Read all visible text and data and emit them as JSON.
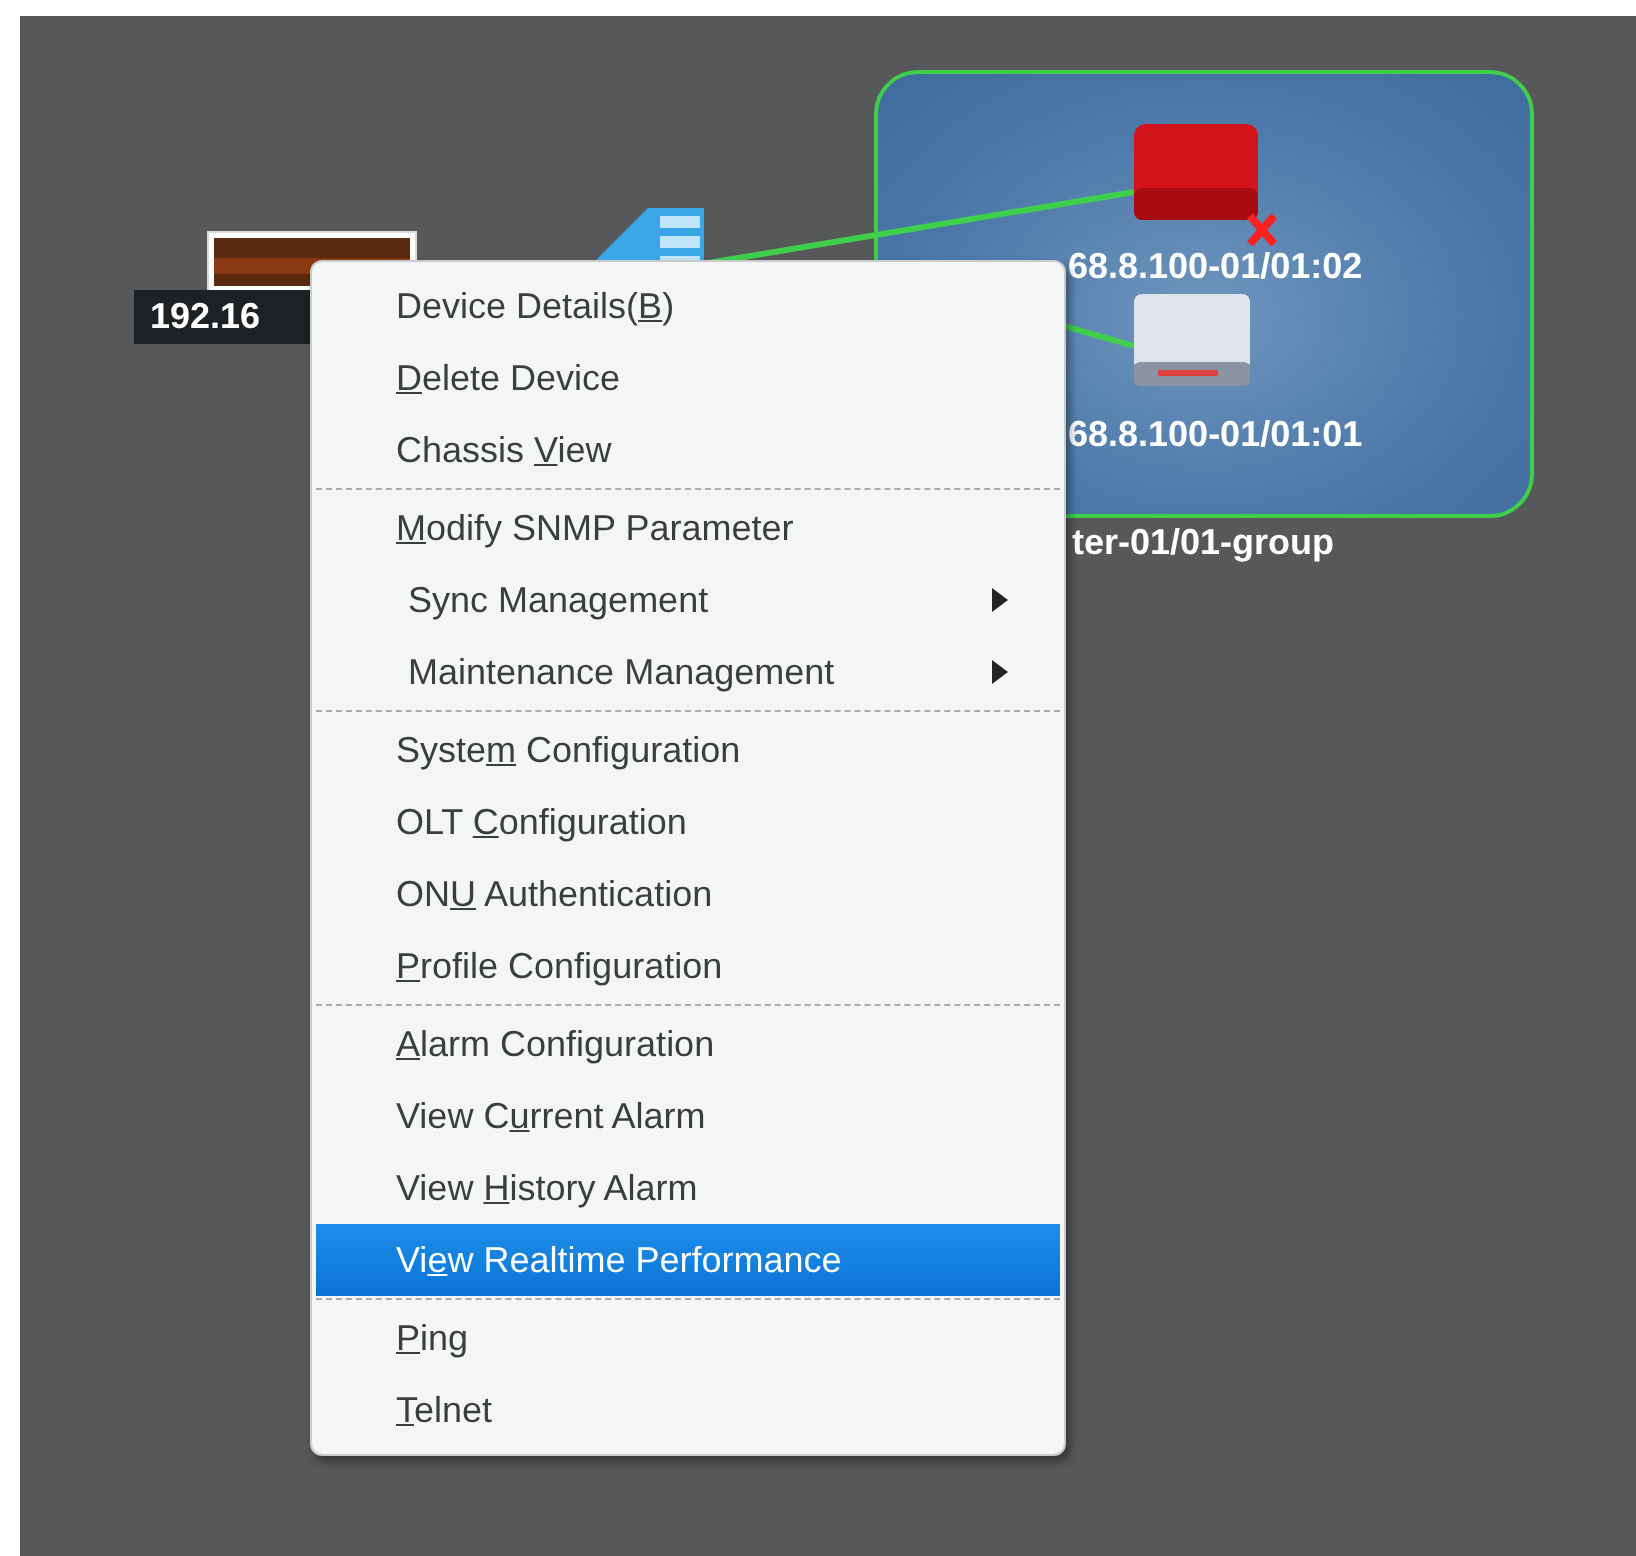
{
  "topology": {
    "nodes": [
      {
        "kind": "olt",
        "label": "192.16"
      },
      {
        "kind": "splitter"
      },
      {
        "kind": "onu-alarm",
        "label": "68.8.100-01/01:02"
      },
      {
        "kind": "onu",
        "label": "68.8.100-01/01:01"
      }
    ],
    "group": {
      "label": "ter-01/01-group"
    }
  },
  "context_menu": {
    "sections": [
      [
        {
          "pre": "Device Details(",
          "key": "B",
          "post": ")",
          "submenu": false,
          "selected": false
        },
        {
          "key": "D",
          "post": "elete Device",
          "submenu": false,
          "selected": false
        },
        {
          "pre": "Chassis ",
          "key": "V",
          "post": "iew",
          "submenu": false,
          "selected": false
        }
      ],
      [
        {
          "key": "M",
          "post": "odify SNMP Parameter",
          "submenu": false,
          "selected": false
        },
        {
          "pre": "Sync Management",
          "submenu": true,
          "selected": false
        },
        {
          "pre": "Maintenance Management",
          "submenu": true,
          "selected": false
        }
      ],
      [
        {
          "pre": "Syste",
          "key": "m",
          "post": " Configuration",
          "submenu": false,
          "selected": false
        },
        {
          "pre": "OLT ",
          "key": "C",
          "post": "onfiguration",
          "submenu": false,
          "selected": false
        },
        {
          "pre": "ON",
          "key": "U",
          "post": " Authentication",
          "submenu": false,
          "selected": false
        },
        {
          "key": "P",
          "post": "rofile Configuration",
          "submenu": false,
          "selected": false
        }
      ],
      [
        {
          "key": "A",
          "post": "larm Configuration",
          "submenu": false,
          "selected": false
        },
        {
          "pre": "View C",
          "key": "u",
          "post": "rrent Alarm",
          "submenu": false,
          "selected": false
        },
        {
          "pre": "View ",
          "key": "H",
          "post": "istory Alarm",
          "submenu": false,
          "selected": false
        },
        {
          "pre": "Vi",
          "key": "e",
          "post": "w Realtime Performance",
          "submenu": false,
          "selected": true
        }
      ],
      [
        {
          "key": "P",
          "post": "ing",
          "submenu": false,
          "selected": false
        },
        {
          "key": "T",
          "post": "elnet",
          "submenu": false,
          "selected": false
        }
      ]
    ]
  }
}
